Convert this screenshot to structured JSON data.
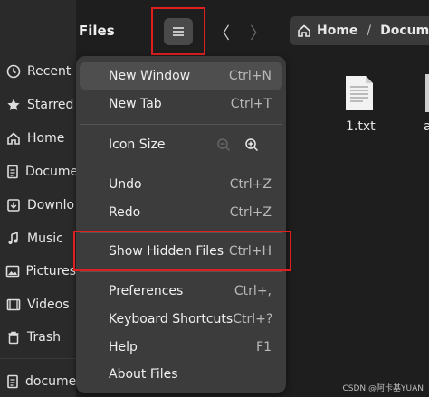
{
  "header": {
    "title": "Files",
    "menu_icon": "hamburger-icon",
    "back_glyph": "〈",
    "forward_glyph": "〉"
  },
  "sidebar": {
    "items": [
      {
        "label": "Recent",
        "icon": "clock-icon"
      },
      {
        "label": "Starred",
        "icon": "star-icon"
      },
      {
        "label": "Home",
        "icon": "home-icon"
      },
      {
        "label": "Docume",
        "icon": "document-icon"
      },
      {
        "label": "Downlo",
        "icon": "download-icon"
      },
      {
        "label": "Music",
        "icon": "music-icon"
      },
      {
        "label": "Pictures",
        "icon": "picture-icon"
      },
      {
        "label": "Videos",
        "icon": "video-icon"
      },
      {
        "label": "Trash",
        "icon": "trash-icon"
      },
      {
        "label": "docume",
        "icon": "document-icon"
      }
    ]
  },
  "pathbar": {
    "home": "Home",
    "separator": "/",
    "current": "Docume"
  },
  "files": [
    {
      "name": "1.txt",
      "icon": "text-file-icon"
    },
    {
      "name": "a",
      "icon": "file-icon"
    }
  ],
  "menu": {
    "items": [
      {
        "label": "New Window",
        "accel": "Ctrl+N"
      },
      {
        "label": "New Tab",
        "accel": "Ctrl+T"
      },
      {
        "label": "Icon Size",
        "accel": ""
      },
      {
        "label": "Undo",
        "accel": "Ctrl+Z"
      },
      {
        "label": "Redo",
        "accel": "Ctrl+Z"
      },
      {
        "label": "Show Hidden Files",
        "accel": "Ctrl+H"
      },
      {
        "label": "Preferences",
        "accel": "Ctrl+,"
      },
      {
        "label": "Keyboard Shortcuts",
        "accel": "Ctrl+?"
      },
      {
        "label": "Help",
        "accel": "F1"
      },
      {
        "label": "About Files",
        "accel": ""
      }
    ]
  },
  "watermark": "CSDN @阿卡基YUAN",
  "colors": {
    "background": "#1e1e1e",
    "sidebar": "#2a2a2a",
    "menu": "#3c3c3c",
    "highlight": "#e02020"
  }
}
